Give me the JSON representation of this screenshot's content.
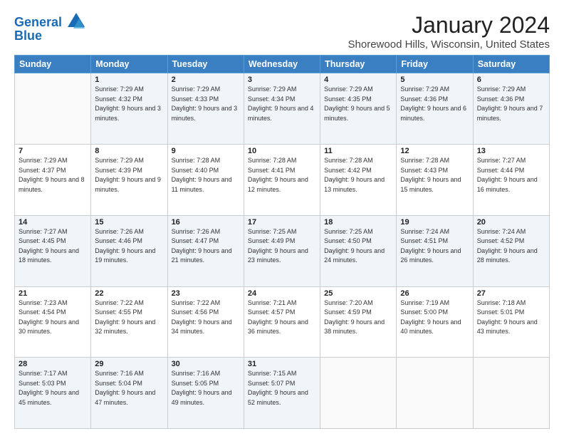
{
  "logo": {
    "line1": "General",
    "line2": "Blue"
  },
  "title": "January 2024",
  "location": "Shorewood Hills, Wisconsin, United States",
  "weekdays": [
    "Sunday",
    "Monday",
    "Tuesday",
    "Wednesday",
    "Thursday",
    "Friday",
    "Saturday"
  ],
  "weeks": [
    [
      {
        "day": "",
        "sunrise": "",
        "sunset": "",
        "daylight": ""
      },
      {
        "day": "1",
        "sunrise": "Sunrise: 7:29 AM",
        "sunset": "Sunset: 4:32 PM",
        "daylight": "Daylight: 9 hours and 3 minutes."
      },
      {
        "day": "2",
        "sunrise": "Sunrise: 7:29 AM",
        "sunset": "Sunset: 4:33 PM",
        "daylight": "Daylight: 9 hours and 3 minutes."
      },
      {
        "day": "3",
        "sunrise": "Sunrise: 7:29 AM",
        "sunset": "Sunset: 4:34 PM",
        "daylight": "Daylight: 9 hours and 4 minutes."
      },
      {
        "day": "4",
        "sunrise": "Sunrise: 7:29 AM",
        "sunset": "Sunset: 4:35 PM",
        "daylight": "Daylight: 9 hours and 5 minutes."
      },
      {
        "day": "5",
        "sunrise": "Sunrise: 7:29 AM",
        "sunset": "Sunset: 4:36 PM",
        "daylight": "Daylight: 9 hours and 6 minutes."
      },
      {
        "day": "6",
        "sunrise": "Sunrise: 7:29 AM",
        "sunset": "Sunset: 4:36 PM",
        "daylight": "Daylight: 9 hours and 7 minutes."
      }
    ],
    [
      {
        "day": "7",
        "sunrise": "Sunrise: 7:29 AM",
        "sunset": "Sunset: 4:37 PM",
        "daylight": "Daylight: 9 hours and 8 minutes."
      },
      {
        "day": "8",
        "sunrise": "Sunrise: 7:29 AM",
        "sunset": "Sunset: 4:39 PM",
        "daylight": "Daylight: 9 hours and 9 minutes."
      },
      {
        "day": "9",
        "sunrise": "Sunrise: 7:28 AM",
        "sunset": "Sunset: 4:40 PM",
        "daylight": "Daylight: 9 hours and 11 minutes."
      },
      {
        "day": "10",
        "sunrise": "Sunrise: 7:28 AM",
        "sunset": "Sunset: 4:41 PM",
        "daylight": "Daylight: 9 hours and 12 minutes."
      },
      {
        "day": "11",
        "sunrise": "Sunrise: 7:28 AM",
        "sunset": "Sunset: 4:42 PM",
        "daylight": "Daylight: 9 hours and 13 minutes."
      },
      {
        "day": "12",
        "sunrise": "Sunrise: 7:28 AM",
        "sunset": "Sunset: 4:43 PM",
        "daylight": "Daylight: 9 hours and 15 minutes."
      },
      {
        "day": "13",
        "sunrise": "Sunrise: 7:27 AM",
        "sunset": "Sunset: 4:44 PM",
        "daylight": "Daylight: 9 hours and 16 minutes."
      }
    ],
    [
      {
        "day": "14",
        "sunrise": "Sunrise: 7:27 AM",
        "sunset": "Sunset: 4:45 PM",
        "daylight": "Daylight: 9 hours and 18 minutes."
      },
      {
        "day": "15",
        "sunrise": "Sunrise: 7:26 AM",
        "sunset": "Sunset: 4:46 PM",
        "daylight": "Daylight: 9 hours and 19 minutes."
      },
      {
        "day": "16",
        "sunrise": "Sunrise: 7:26 AM",
        "sunset": "Sunset: 4:47 PM",
        "daylight": "Daylight: 9 hours and 21 minutes."
      },
      {
        "day": "17",
        "sunrise": "Sunrise: 7:25 AM",
        "sunset": "Sunset: 4:49 PM",
        "daylight": "Daylight: 9 hours and 23 minutes."
      },
      {
        "day": "18",
        "sunrise": "Sunrise: 7:25 AM",
        "sunset": "Sunset: 4:50 PM",
        "daylight": "Daylight: 9 hours and 24 minutes."
      },
      {
        "day": "19",
        "sunrise": "Sunrise: 7:24 AM",
        "sunset": "Sunset: 4:51 PM",
        "daylight": "Daylight: 9 hours and 26 minutes."
      },
      {
        "day": "20",
        "sunrise": "Sunrise: 7:24 AM",
        "sunset": "Sunset: 4:52 PM",
        "daylight": "Daylight: 9 hours and 28 minutes."
      }
    ],
    [
      {
        "day": "21",
        "sunrise": "Sunrise: 7:23 AM",
        "sunset": "Sunset: 4:54 PM",
        "daylight": "Daylight: 9 hours and 30 minutes."
      },
      {
        "day": "22",
        "sunrise": "Sunrise: 7:22 AM",
        "sunset": "Sunset: 4:55 PM",
        "daylight": "Daylight: 9 hours and 32 minutes."
      },
      {
        "day": "23",
        "sunrise": "Sunrise: 7:22 AM",
        "sunset": "Sunset: 4:56 PM",
        "daylight": "Daylight: 9 hours and 34 minutes."
      },
      {
        "day": "24",
        "sunrise": "Sunrise: 7:21 AM",
        "sunset": "Sunset: 4:57 PM",
        "daylight": "Daylight: 9 hours and 36 minutes."
      },
      {
        "day": "25",
        "sunrise": "Sunrise: 7:20 AM",
        "sunset": "Sunset: 4:59 PM",
        "daylight": "Daylight: 9 hours and 38 minutes."
      },
      {
        "day": "26",
        "sunrise": "Sunrise: 7:19 AM",
        "sunset": "Sunset: 5:00 PM",
        "daylight": "Daylight: 9 hours and 40 minutes."
      },
      {
        "day": "27",
        "sunrise": "Sunrise: 7:18 AM",
        "sunset": "Sunset: 5:01 PM",
        "daylight": "Daylight: 9 hours and 43 minutes."
      }
    ],
    [
      {
        "day": "28",
        "sunrise": "Sunrise: 7:17 AM",
        "sunset": "Sunset: 5:03 PM",
        "daylight": "Daylight: 9 hours and 45 minutes."
      },
      {
        "day": "29",
        "sunrise": "Sunrise: 7:16 AM",
        "sunset": "Sunset: 5:04 PM",
        "daylight": "Daylight: 9 hours and 47 minutes."
      },
      {
        "day": "30",
        "sunrise": "Sunrise: 7:16 AM",
        "sunset": "Sunset: 5:05 PM",
        "daylight": "Daylight: 9 hours and 49 minutes."
      },
      {
        "day": "31",
        "sunrise": "Sunrise: 7:15 AM",
        "sunset": "Sunset: 5:07 PM",
        "daylight": "Daylight: 9 hours and 52 minutes."
      },
      {
        "day": "",
        "sunrise": "",
        "sunset": "",
        "daylight": ""
      },
      {
        "day": "",
        "sunrise": "",
        "sunset": "",
        "daylight": ""
      },
      {
        "day": "",
        "sunrise": "",
        "sunset": "",
        "daylight": ""
      }
    ]
  ]
}
